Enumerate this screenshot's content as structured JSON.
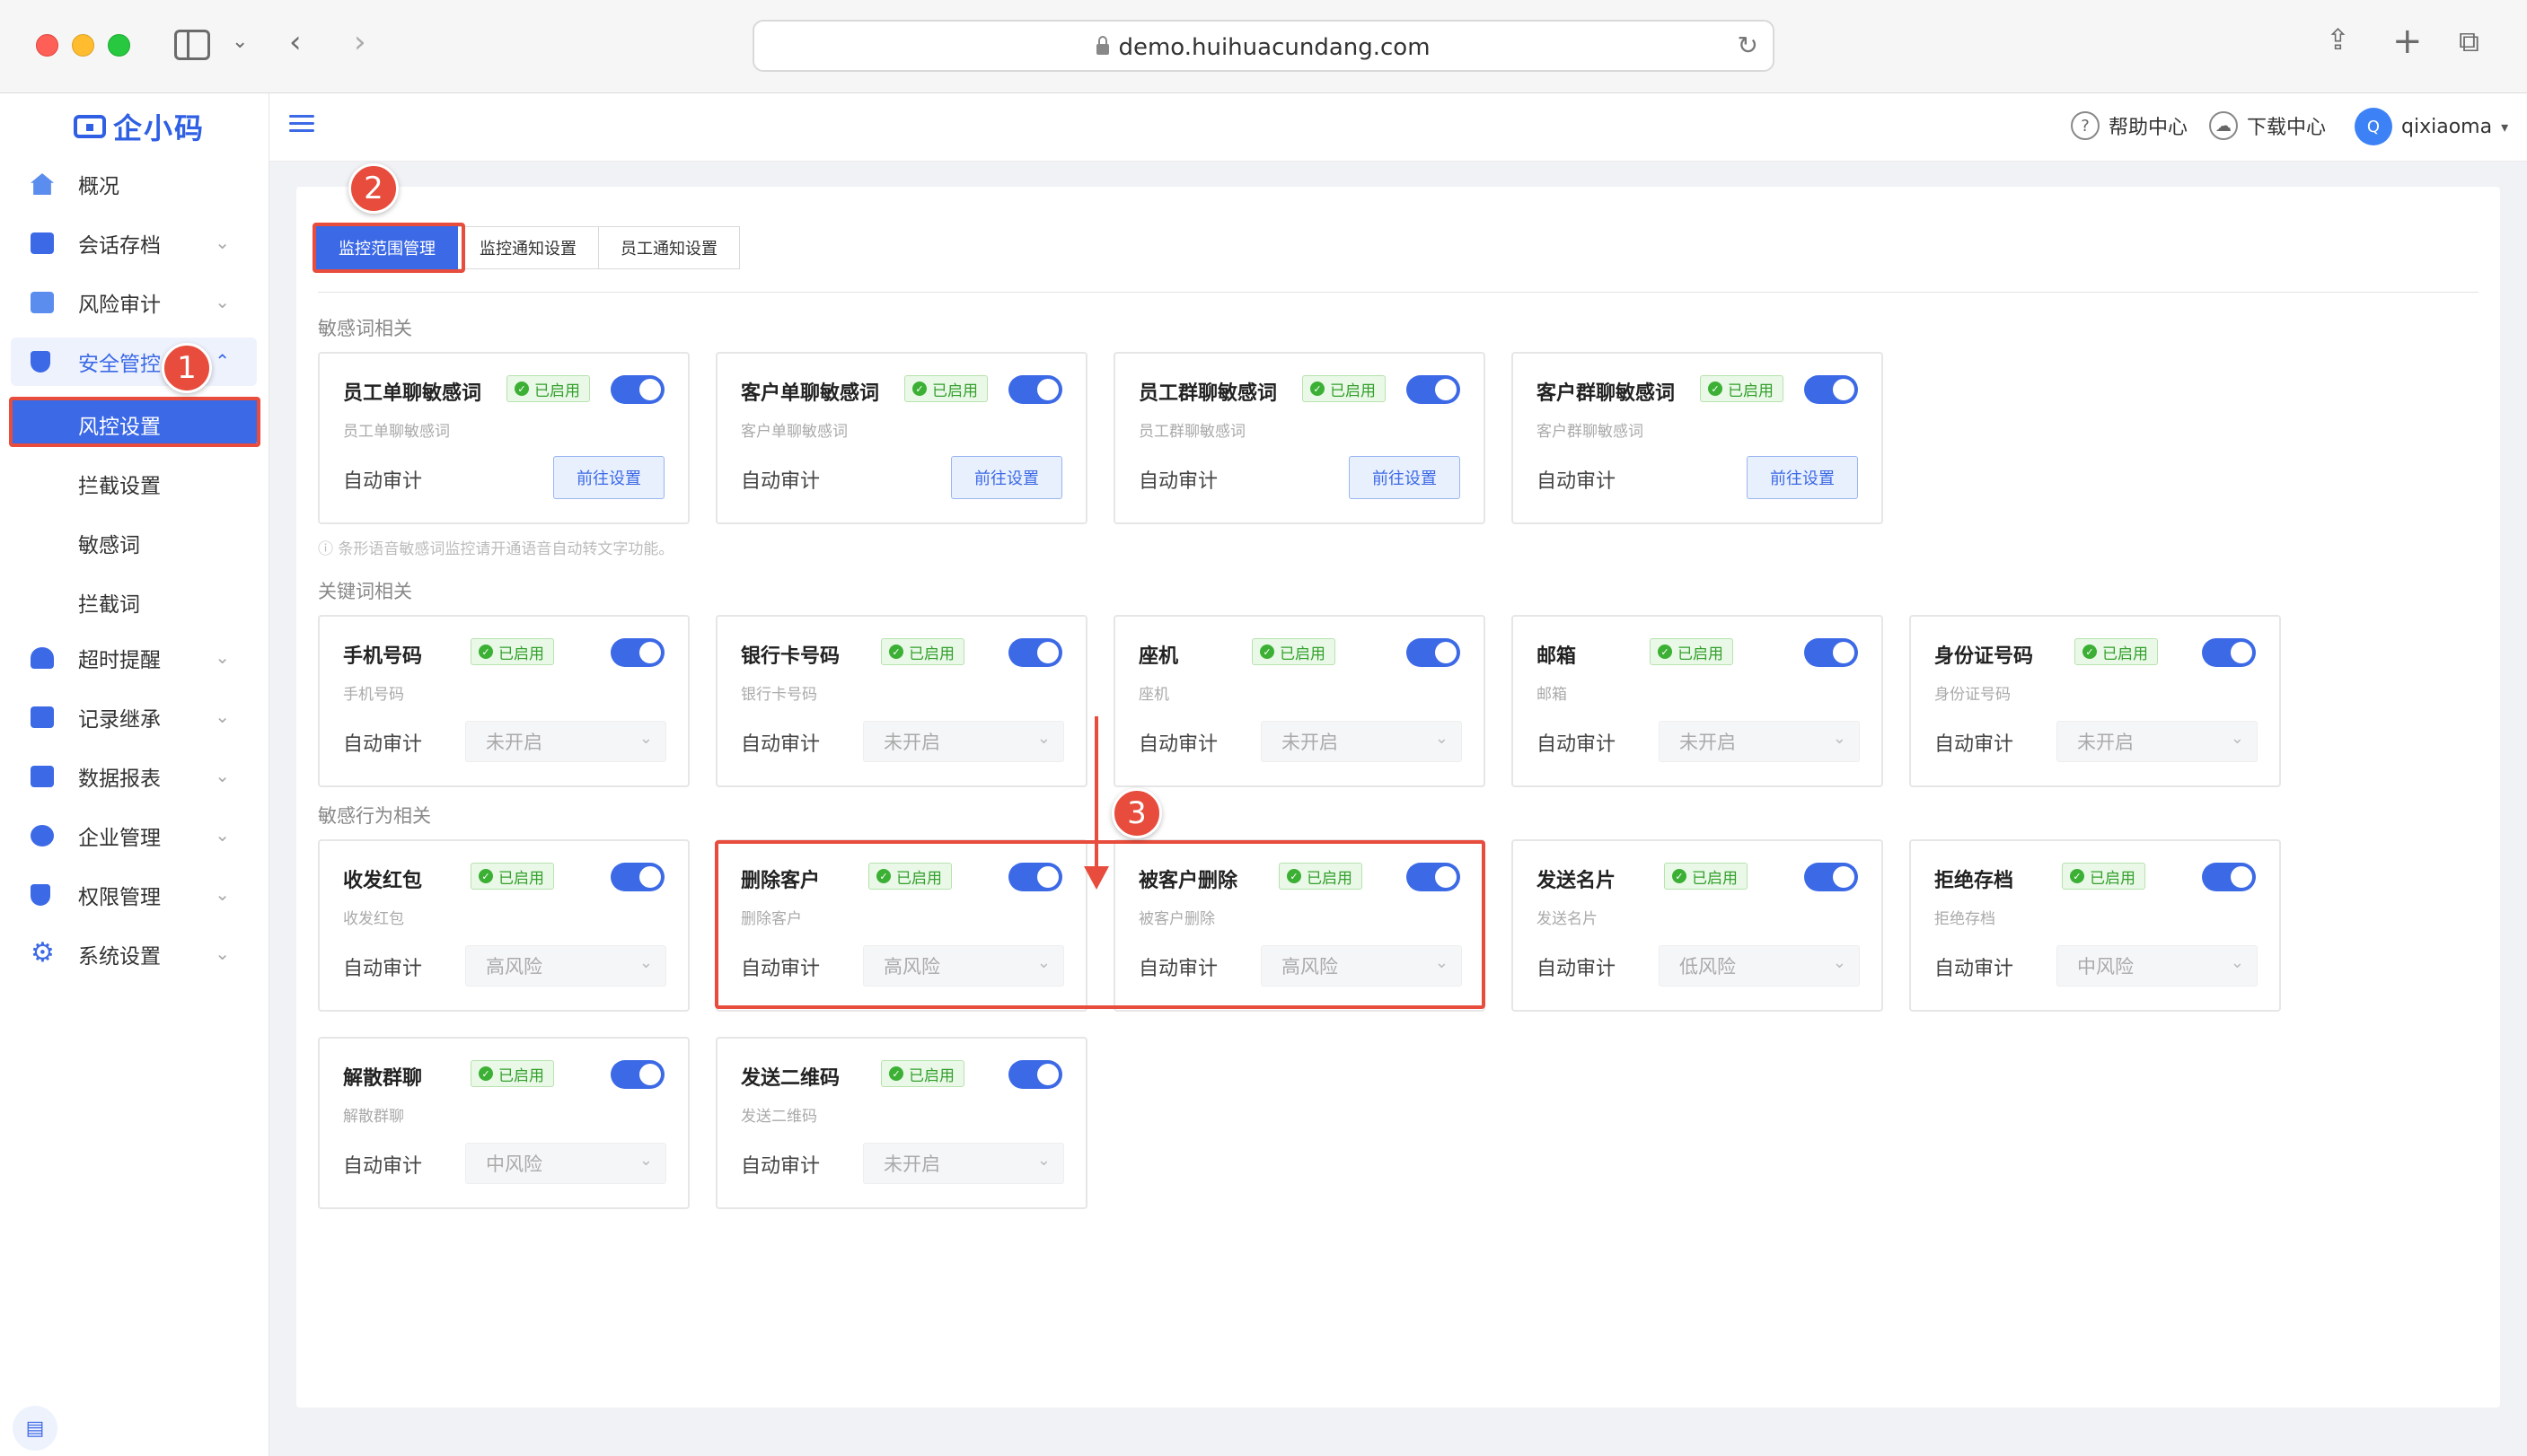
{
  "browser": {
    "url": "demo.huihuacundang.com"
  },
  "header": {
    "help": "帮助中心",
    "download": "下载中心",
    "avatar_letter": "Q",
    "username": "qixiaoma"
  },
  "sidebar": {
    "logo": "企小码",
    "items": [
      {
        "label": "概况",
        "icon": "home-icon"
      },
      {
        "label": "会话存档",
        "icon": "folder-icon"
      },
      {
        "label": "风险审计",
        "icon": "audit-icon"
      },
      {
        "label": "安全管控",
        "icon": "shield-icon"
      },
      {
        "label": "超时提醒",
        "icon": "bell-icon"
      },
      {
        "label": "记录继承",
        "icon": "inherit-icon"
      },
      {
        "label": "数据报表",
        "icon": "report-icon"
      },
      {
        "label": "企业管理",
        "icon": "enterprise-icon"
      },
      {
        "label": "权限管理",
        "icon": "permission-icon"
      },
      {
        "label": "系统设置",
        "icon": "gear-icon"
      }
    ],
    "sub_items": [
      "风控设置",
      "拦截设置",
      "敏感词",
      "拦截词"
    ]
  },
  "annotations": [
    "1",
    "2",
    "3"
  ],
  "tabs": [
    "监控范围管理",
    "监控通知设置",
    "员工通知设置"
  ],
  "common": {
    "enabled": "已启用",
    "auto_audit": "自动审计",
    "go_setting": "前往设置"
  },
  "sections": {
    "sensitive_words": {
      "title": "敏感词相关",
      "hint": "条形语音敏感词监控请开通语音自动转文字功能。",
      "cards": [
        {
          "name": "员工单聊敏感词",
          "sub": "员工单聊敏感词"
        },
        {
          "name": "客户单聊敏感词",
          "sub": "客户单聊敏感词"
        },
        {
          "name": "员工群聊敏感词",
          "sub": "员工群聊敏感词"
        },
        {
          "name": "客户群聊敏感词",
          "sub": "客户群聊敏感词"
        }
      ]
    },
    "keywords": {
      "title": "关键词相关",
      "cards": [
        {
          "name": "手机号码",
          "sub": "手机号码",
          "level": "未开启"
        },
        {
          "name": "银行卡号码",
          "sub": "银行卡号码",
          "level": "未开启"
        },
        {
          "name": "座机",
          "sub": "座机",
          "level": "未开启"
        },
        {
          "name": "邮箱",
          "sub": "邮箱",
          "level": "未开启"
        },
        {
          "name": "身份证号码",
          "sub": "身份证号码",
          "level": "未开启"
        }
      ]
    },
    "behaviors": {
      "title": "敏感行为相关",
      "cards": [
        {
          "name": "收发红包",
          "sub": "收发红包",
          "level": "高风险"
        },
        {
          "name": "删除客户",
          "sub": "删除客户",
          "level": "高风险"
        },
        {
          "name": "被客户删除",
          "sub": "被客户删除",
          "level": "高风险"
        },
        {
          "name": "发送名片",
          "sub": "发送名片",
          "level": "低风险"
        },
        {
          "name": "拒绝存档",
          "sub": "拒绝存档",
          "level": "中风险"
        },
        {
          "name": "解散群聊",
          "sub": "解散群聊",
          "level": "中风险"
        },
        {
          "name": "发送二维码",
          "sub": "发送二维码",
          "level": "未开启"
        }
      ]
    }
  }
}
